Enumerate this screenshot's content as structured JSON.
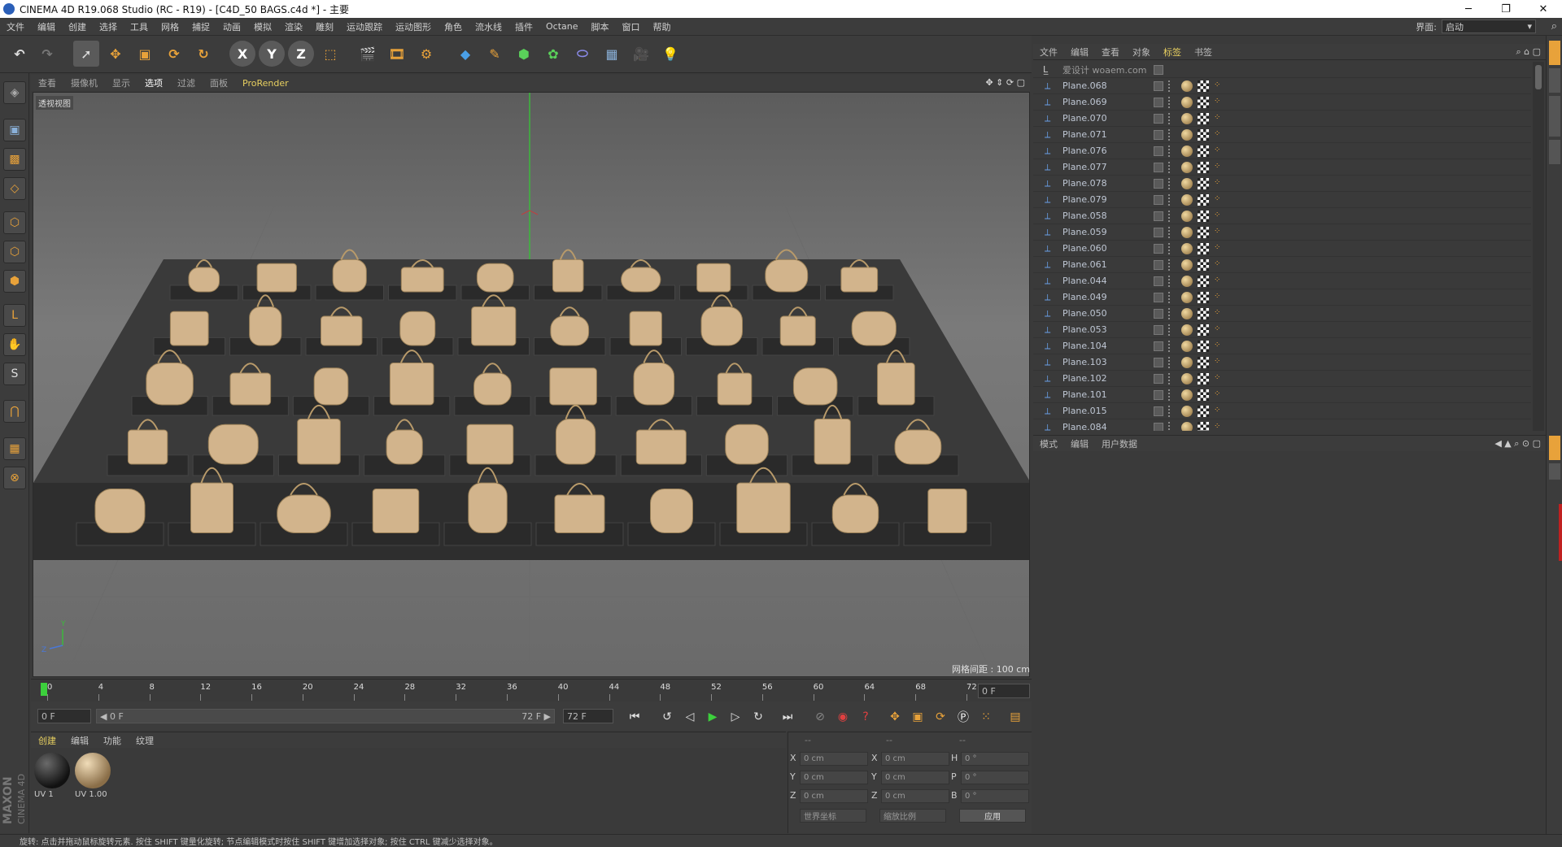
{
  "window": {
    "title": "CINEMA 4D R19.068 Studio (RC - R19) - [C4D_50 BAGS.c4d *] - 主要"
  },
  "menubar": {
    "items": [
      "文件",
      "编辑",
      "创建",
      "选择",
      "工具",
      "网格",
      "捕捉",
      "动画",
      "模拟",
      "渲染",
      "雕刻",
      "运动跟踪",
      "运动图形",
      "角色",
      "流水线",
      "插件",
      "Octane",
      "脚本",
      "窗口",
      "帮助"
    ],
    "layout_label": "界面:",
    "layout_value": "启动"
  },
  "viewport": {
    "menu": [
      "查看",
      "摄像机",
      "显示",
      "选项",
      "过滤",
      "面板",
      "ProRender"
    ],
    "label": "透视视图",
    "grid_info": "网格间距 : 100 cm"
  },
  "timeline": {
    "ticks": [
      "0",
      "4",
      "8",
      "12",
      "16",
      "20",
      "24",
      "28",
      "32",
      "36",
      "40",
      "44",
      "48",
      "52",
      "56",
      "60",
      "64",
      "68",
      "72"
    ],
    "current_frame": "0 F"
  },
  "transport": {
    "start_field": "0 F",
    "range_left": "◀ 0 F",
    "range_right": "72 F ▶",
    "end_field": "72 F"
  },
  "material_manager": {
    "menu": [
      "创建",
      "编辑",
      "功能",
      "纹理"
    ],
    "materials": [
      {
        "label": "UV 1",
        "color": "#1a1a1a"
      },
      {
        "label": "UV 1.00",
        "color": "#c7b08a"
      }
    ]
  },
  "coordinates": {
    "headers": [
      "--",
      "--",
      "--"
    ],
    "rows": [
      {
        "l1": "X",
        "v1": "0 cm",
        "l2": "X",
        "v2": "0 cm",
        "l3": "H",
        "v3": "0 °"
      },
      {
        "l1": "Y",
        "v1": "0 cm",
        "l2": "Y",
        "v2": "0 cm",
        "l3": "P",
        "v3": "0 °"
      },
      {
        "l1": "Z",
        "v1": "0 cm",
        "l2": "Z",
        "v2": "0 cm",
        "l3": "B",
        "v3": "0 °"
      }
    ],
    "mode_world": "世界坐标",
    "mode_scale": "缩放比例",
    "apply": "应用"
  },
  "object_manager": {
    "menu": [
      "文件",
      "编辑",
      "查看",
      "对象",
      "标签",
      "书签"
    ],
    "root": "爱设计 woaem.com",
    "objects": [
      "Plane.068",
      "Plane.069",
      "Plane.070",
      "Plane.071",
      "Plane.076",
      "Plane.077",
      "Plane.078",
      "Plane.079",
      "Plane.058",
      "Plane.059",
      "Plane.060",
      "Plane.061",
      "Plane.044",
      "Plane.049",
      "Plane.050",
      "Plane.053",
      "Plane.104",
      "Plane.103",
      "Plane.102",
      "Plane.101",
      "Plane.015",
      "Plane.084"
    ]
  },
  "attribute_manager": {
    "menu": [
      "模式",
      "编辑",
      "用户数据"
    ]
  },
  "status": {
    "text": "旋转: 点击并拖动鼠标旋转元素. 按住 SHIFT 键量化旋转; 节点编辑模式时按住 SHIFT 键增加选择对象; 按住 CTRL 键减少选择对象。"
  },
  "branding": {
    "maxon": "MAXON",
    "product": "CINEMA 4D"
  },
  "colors": {
    "accent": "#e8a23a",
    "bag": "#d2b48c",
    "background": "#3a3a3a"
  }
}
